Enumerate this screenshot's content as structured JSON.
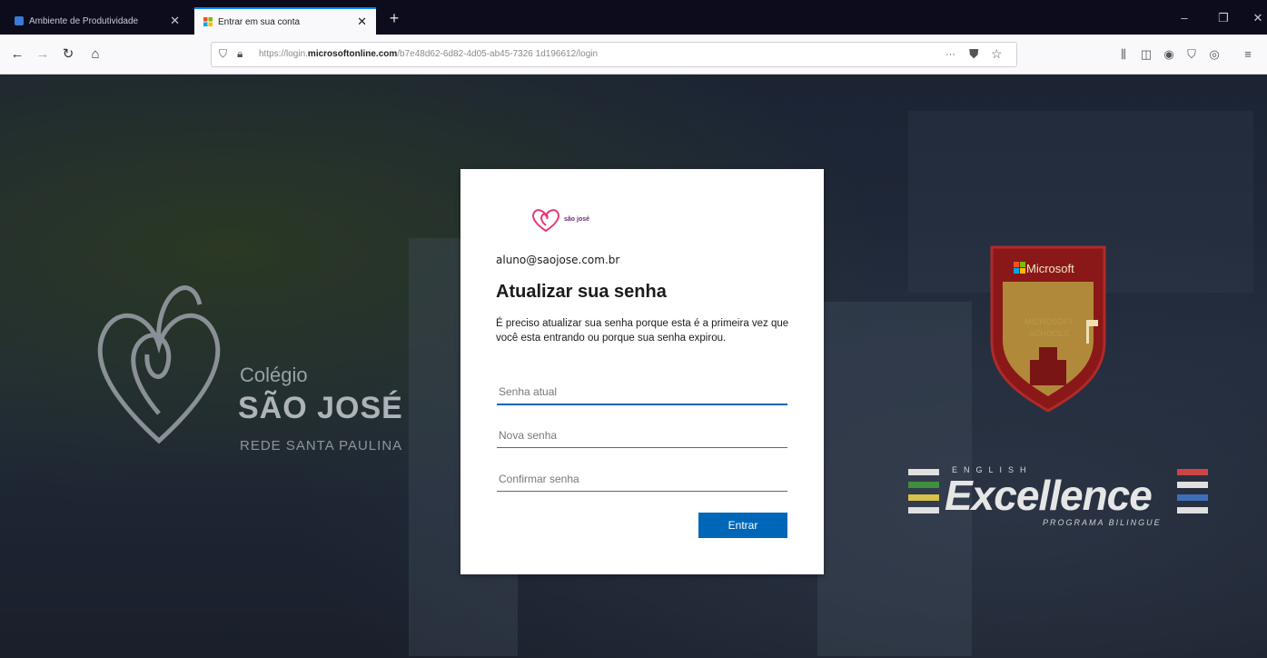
{
  "browser": {
    "tabs": [
      {
        "label": "Ambiente de Produtividade",
        "active": false
      },
      {
        "label": "Entrar em sua conta",
        "active": true
      }
    ],
    "url_prefix": "https://login.",
    "url_domain": "microsoftonline.com",
    "url_path": "/b7e48d62-6d82-4d05-ab45-7326 1d196612/login",
    "url_more": "···"
  },
  "background": {
    "school_small": "Colégio",
    "school_big": "SÃO JOSÉ",
    "school_sub": "REDE SANTA PAULINA",
    "badge_brand": "Microsoft",
    "badge_text": "MICROSOFT SCHOOLS",
    "excellence_top": "ENGLISH",
    "excellence_word": "Excellence",
    "excellence_bottom": "PROGRAMA BILINGUE"
  },
  "card": {
    "logo_text": "são josé",
    "identity": "aluno@saojose.com.br",
    "title": "Atualizar sua senha",
    "description": "É preciso atualizar sua senha porque esta é a primeira vez que você esta entrando ou porque sua senha expirou.",
    "fields": {
      "current_password": {
        "placeholder": "Senha atual",
        "value": ""
      },
      "new_password": {
        "placeholder": "Nova senha",
        "value": ""
      },
      "confirm_password": {
        "placeholder": "Confirmar senha",
        "value": ""
      }
    },
    "submit_label": "Entrar"
  },
  "colors": {
    "accent": "#0067b8",
    "logo_pink": "#e8357a",
    "tab_indicator": "#0a84ff",
    "badge_red": "#9b1c1c",
    "badge_gold": "#c8a24a"
  },
  "icons": [
    "back-icon",
    "forward-icon",
    "reload-icon",
    "home-icon",
    "shield-icon",
    "lock-icon",
    "pocket-icon",
    "star-icon",
    "library-icon",
    "sidebar-icon",
    "extension-icon",
    "menu-icon"
  ]
}
